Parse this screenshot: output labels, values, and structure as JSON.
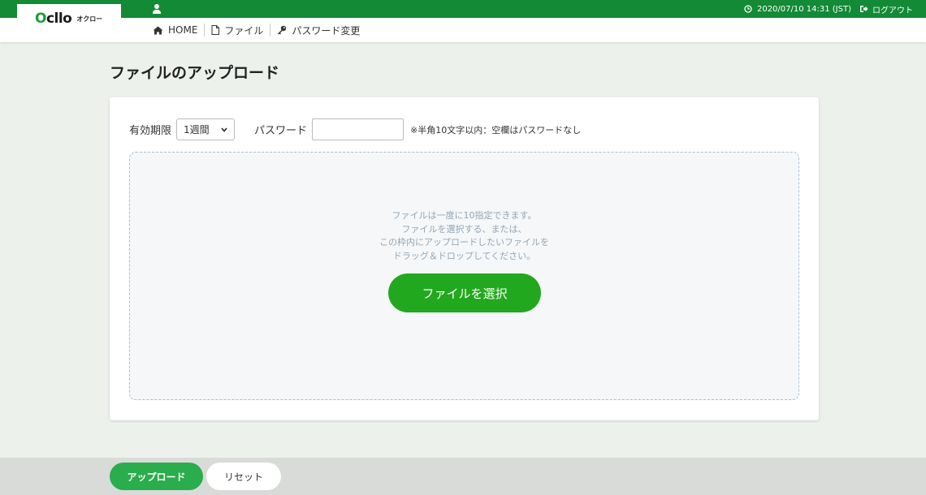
{
  "header": {
    "logo_text": "cllo",
    "logo_subtitle": "オクロー",
    "datetime": "2020/07/10 14:31 (JST)",
    "logout_label": "ログアウト"
  },
  "nav": {
    "items": [
      {
        "label": "HOME",
        "icon": "home-icon"
      },
      {
        "label": "ファイル",
        "icon": "file-icon"
      },
      {
        "label": "パスワード変更",
        "icon": "key-icon"
      }
    ]
  },
  "page": {
    "title": "ファイルのアップロード"
  },
  "form": {
    "expiry_label": "有効期限",
    "expiry_value": "1週間",
    "password_label": "パスワード",
    "password_value": "",
    "password_note": "※半角10文字以内：空欄はパスワードなし"
  },
  "dropzone": {
    "lines": [
      "ファイルは一度に10指定できます。",
      "ファイルを選択する、または、",
      "この枠内にアップロードしたいファイルを",
      "ドラッグ＆ドロップしてください。"
    ],
    "select_button": "ファイルを選択"
  },
  "footer": {
    "upload_button": "アップロード",
    "reset_button": "リセット"
  },
  "colors": {
    "brand_green": "#138a36",
    "button_green": "#22a81e",
    "upload_green": "#2aad4c",
    "dropzone_border": "#a9bed3"
  }
}
